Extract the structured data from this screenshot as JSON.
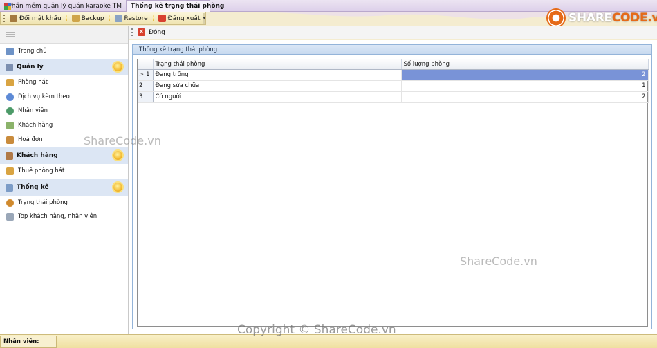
{
  "tabs": {
    "app_tab": "Phần mềm quản lý quán karaoke TM",
    "active_tab": "Thống kê trạng thái phòng"
  },
  "toolbar": {
    "change_password": "Đổi mật khẩu",
    "backup": "Backup",
    "restore": "Restore",
    "logout": "Đăng xuất"
  },
  "logo": {
    "brand_part1": "SHARE",
    "brand_part2": "CODE.vn"
  },
  "sidebar": {
    "home": "Trang chủ",
    "groups": [
      {
        "title": "Quản lý",
        "items": [
          "Phòng hát",
          "Dịch vụ kèm theo",
          "Nhân viên",
          "Khách hàng",
          "Hoá đơn"
        ]
      },
      {
        "title": "Khách hàng",
        "items": [
          "Thuê phòng hát"
        ]
      },
      {
        "title": "Thống kê",
        "items": [
          "Trạng thái phòng",
          "Top khách hàng, nhân viên"
        ]
      }
    ]
  },
  "main": {
    "close_label": "Đóng",
    "group_title": "Thống kê trạng thái phòng",
    "grid": {
      "columns": [
        "Trạng thái phòng",
        "Số lượng phòng"
      ],
      "rows": [
        {
          "index": "1",
          "status": "Đang trống",
          "count": "2"
        },
        {
          "index": "2",
          "status": "Đang sửa chữa",
          "count": "1"
        },
        {
          "index": "3",
          "status": "Có người",
          "count": "2"
        }
      ],
      "current_row_marker": ">"
    }
  },
  "statusbar": {
    "user_label": "Nhân viên: admin"
  },
  "watermarks": {
    "sidebar": "ShareCode.vn",
    "main": "ShareCode.vn",
    "copyright": "Copyright © ShareCode.vn"
  },
  "colors": {
    "selection": "#7993d7",
    "header_band": "#dce6f4",
    "accent_orange": "#e66a17"
  }
}
